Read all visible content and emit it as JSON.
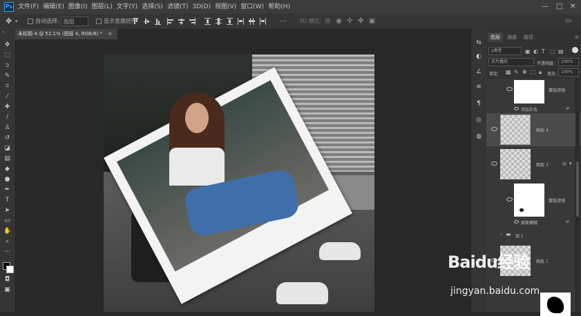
{
  "app": {
    "logo": "Ps"
  },
  "menu": {
    "items": [
      "文件(F)",
      "编辑(E)",
      "图像(I)",
      "图层(L)",
      "文字(Y)",
      "选择(S)",
      "滤镜(T)",
      "3D(D)",
      "视图(V)",
      "窗口(W)",
      "帮助(H)"
    ],
    "window_controls": [
      "—",
      "□",
      "✕"
    ]
  },
  "options": {
    "auto_select_label": "自动选择:",
    "auto_select_value": "图层",
    "transform_label": "显示变换控件",
    "mode_3d_label": "3D 模式:"
  },
  "document": {
    "tab_title": "未标题-4 @ 52.1% (图层 4, RGB/8) *",
    "tab_close": "×"
  },
  "layers_panel": {
    "tabs": [
      "图层",
      "通道",
      "路径"
    ],
    "kind_filter": "ρ类型",
    "blend_mode": "正片叠底",
    "opacity_label": "不透明度:",
    "opacity_value": "100%",
    "lock_label": "锁定:",
    "fill_label": "填充:",
    "fill_value": "100%",
    "layers": [
      {
        "name": "蒙版滤镜",
        "sub": "添加杂色"
      },
      {
        "name": "图层 4",
        "sub": ""
      },
      {
        "name": "图层 3",
        "sub": ""
      },
      {
        "name": "蒙版滤镜",
        "sub": "高斯模糊"
      },
      {
        "name": "组 1",
        "sub": ""
      },
      {
        "name": "图层 1",
        "sub": ""
      }
    ]
  },
  "watermark": {
    "brand": "Baidu经验",
    "url": "jingyan.baidu.com"
  },
  "colors": {
    "menubar": "#3b3b3b",
    "panel": "#323232",
    "selected_layer": "#4a4a4a",
    "accent": "#31a8ff"
  }
}
